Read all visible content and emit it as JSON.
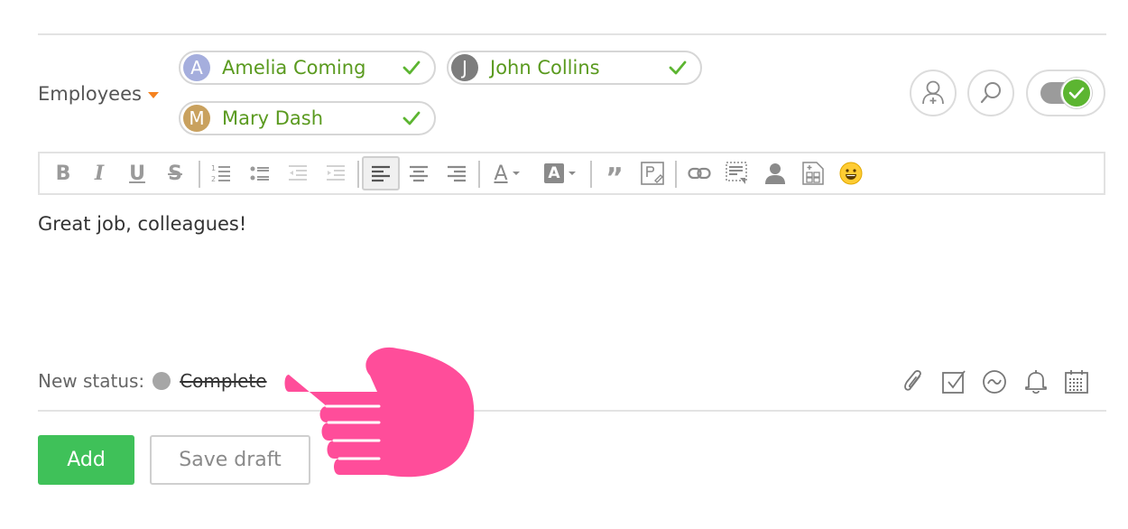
{
  "employees": {
    "label": "Employees",
    "chips": [
      {
        "initial": "A",
        "name": "Amelia Coming",
        "avatar_color": "#a5aedd"
      },
      {
        "initial": "J",
        "name": "John Collins",
        "avatar_color": "#7d7d7d"
      },
      {
        "initial": "M",
        "name": "Mary Dash",
        "avatar_color": "#c9a15e"
      }
    ]
  },
  "actions": {
    "add_participant_icon": "add-user-icon",
    "search_icon": "search-icon",
    "toggle_state": "on"
  },
  "toolbar": {
    "buttons": [
      "bold",
      "italic",
      "underline",
      "strikethrough",
      "ordered-list",
      "unordered-list",
      "outdent",
      "indent",
      "align-left",
      "align-center",
      "align-right",
      "font-color",
      "highlight-color",
      "quote",
      "insert-image",
      "link",
      "insert-template",
      "insert-user",
      "insert-table",
      "emoji"
    ],
    "bold_glyph": "B",
    "italic_glyph": "I",
    "underline_glyph": "U",
    "strike_glyph": "S",
    "font_color_glyph": "A",
    "highlight_glyph": "A",
    "quote_glyph": "”"
  },
  "editor": {
    "text": "Great job, colleagues!"
  },
  "status": {
    "label": "New status:",
    "value": "Complete"
  },
  "bottom_icons": [
    "paperclip-icon",
    "checkbox-icon",
    "clock-icon",
    "bell-icon",
    "calendar-icon"
  ],
  "buttons": {
    "add": "Add",
    "save_draft": "Save draft"
  },
  "colors": {
    "accent_green": "#3fc159",
    "chip_name_green": "#5a9a1f",
    "caret_orange": "#f5821f",
    "pointer_pink": "#ff4d9a"
  }
}
